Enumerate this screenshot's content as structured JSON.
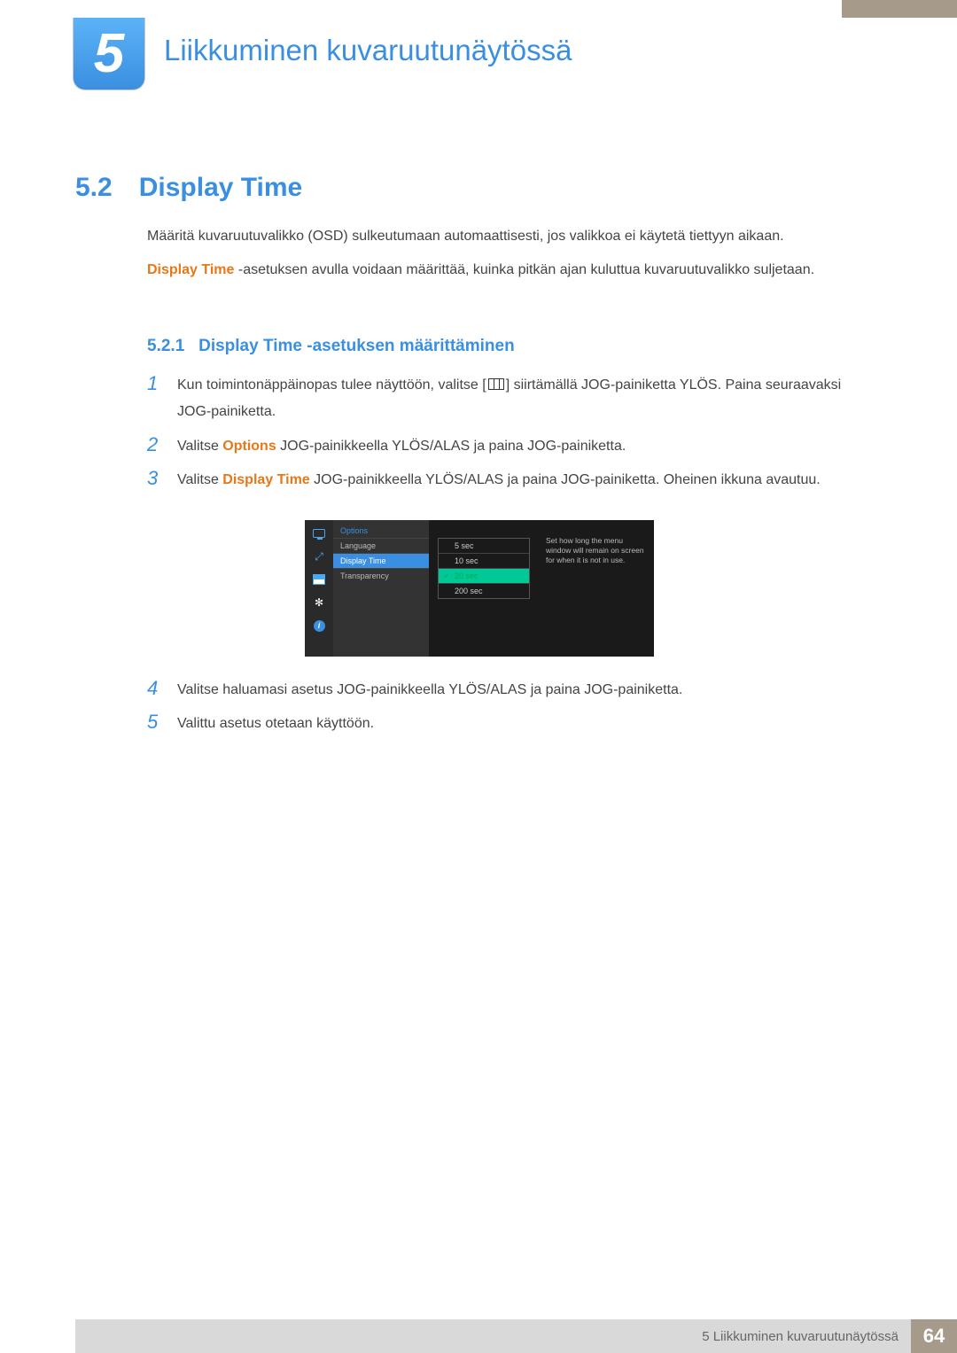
{
  "chapter": {
    "number": "5",
    "title": "Liikkuminen kuvaruutunäytössä"
  },
  "section": {
    "number": "5.2",
    "title": "Display Time"
  },
  "paragraphs": {
    "p1": "Määritä kuvaruutuvalikko (OSD) sulkeutumaan automaattisesti, jos valikkoa ei käytetä tiettyyn aikaan.",
    "p2_highlight": "Display Time",
    "p2_rest": " -asetuksen avulla voidaan määrittää, kuinka pitkän ajan kuluttua kuvaruutuvalikko suljetaan."
  },
  "subsection": {
    "number": "5.2.1",
    "title": "Display Time -asetuksen määrittäminen"
  },
  "steps": {
    "s1a": "Kun toimintonäppäinopas tulee näyttöön, valitse [",
    "s1b": "] siirtämällä JOG-painiketta YLÖS. Paina seuraavaksi JOG-painiketta.",
    "s2_pre": "Valitse ",
    "s2_hl": "Options",
    "s2_post": " JOG-painikkeella YLÖS/ALAS ja paina JOG-painiketta.",
    "s3_pre": "Valitse ",
    "s3_hl": "Display Time",
    "s3_post": " JOG-painikkeella YLÖS/ALAS ja paina JOG-painiketta. Oheinen ikkuna avautuu.",
    "s4": "Valitse haluamasi asetus JOG-painikkeella YLÖS/ALAS ja paina JOG-painiketta.",
    "s5": "Valittu asetus otetaan käyttöön."
  },
  "step_nums": {
    "n1": "1",
    "n2": "2",
    "n3": "3",
    "n4": "4",
    "n5": "5"
  },
  "osd": {
    "header": "Options",
    "items": [
      "Language",
      "Display Time",
      "Transparency"
    ],
    "options": [
      "5 sec",
      "10 sec",
      "20 sec",
      "200 sec"
    ],
    "desc": "Set how long the menu window will remain on screen for when it is not in use.",
    "info_glyph": "i"
  },
  "footer": {
    "text": "5 Liikkuminen kuvaruutunäytössä",
    "page": "64"
  }
}
